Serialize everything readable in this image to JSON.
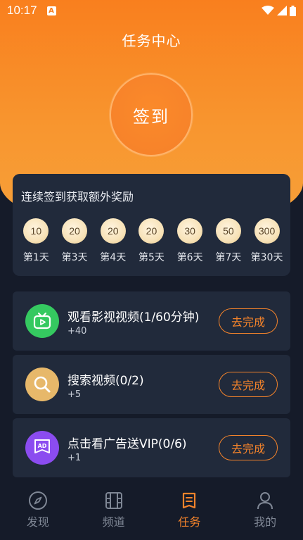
{
  "status_bar": {
    "time": "10:17",
    "a_icon": "A"
  },
  "page": {
    "title": "任务中心"
  },
  "checkin": {
    "label": "签到"
  },
  "rewards": {
    "title": "连续签到获取额外奖励",
    "days": [
      {
        "value": "10",
        "label": "第1天"
      },
      {
        "value": "20",
        "label": "第3天"
      },
      {
        "value": "20",
        "label": "第4天"
      },
      {
        "value": "20",
        "label": "第5天"
      },
      {
        "value": "30",
        "label": "第6天"
      },
      {
        "value": "50",
        "label": "第7天"
      },
      {
        "value": "300",
        "label": "第30天"
      }
    ]
  },
  "tasks": [
    {
      "name": "观看影视视频(1/60分钟)",
      "reward": "+40",
      "button": "去完成",
      "icon": "tv-icon",
      "color": "#35c960"
    },
    {
      "name": "搜索视频(0/2)",
      "reward": "+5",
      "button": "去完成",
      "icon": "search-icon",
      "color": "#e7b86a"
    },
    {
      "name": "点击看广告送VIP(0/6)",
      "reward": "+1",
      "button": "去完成",
      "icon": "ad-icon",
      "color": "#8b4cf0"
    }
  ],
  "tabbar": [
    {
      "label": "发现",
      "icon": "compass-icon"
    },
    {
      "label": "频道",
      "icon": "film-icon"
    },
    {
      "label": "任务",
      "icon": "task-icon",
      "active": true
    },
    {
      "label": "我的",
      "icon": "user-icon"
    }
  ],
  "colors": {
    "accent": "#f3832b",
    "background": "#151b29",
    "card": "#212a3b"
  }
}
